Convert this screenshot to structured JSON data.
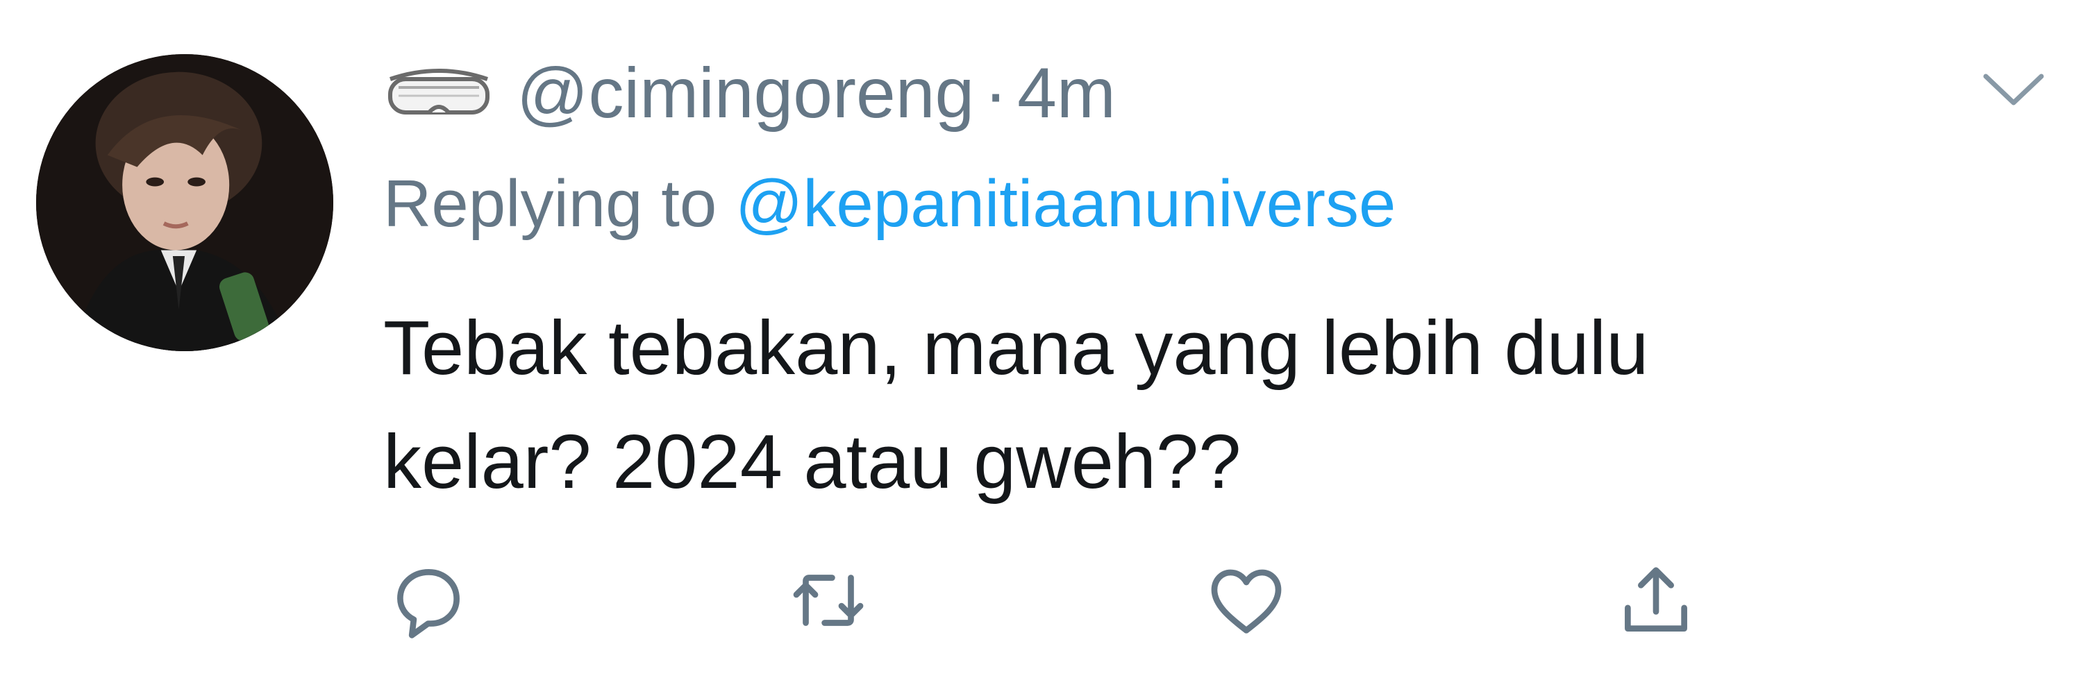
{
  "tweet": {
    "username_icon": "goggles-emoji-icon",
    "handle": "@cimingoreng",
    "separator": "·",
    "time": "4m",
    "replying_prefix": "Replying to",
    "replying_to": "@kepanitiaanuniverse",
    "text_lines": [
      "Tebak tebakan, mana yang lebih dulu",
      "kelar? 2024 atau gweh??"
    ]
  },
  "icons": {
    "menu": "chevron-down-icon",
    "reply": "reply-icon",
    "retweet": "retweet-icon",
    "like": "heart-icon",
    "share": "share-icon"
  },
  "colors": {
    "secondary_text": "#657786",
    "link": "#1da1f2",
    "primary_text": "#14171a",
    "action_icon": "#657786"
  }
}
